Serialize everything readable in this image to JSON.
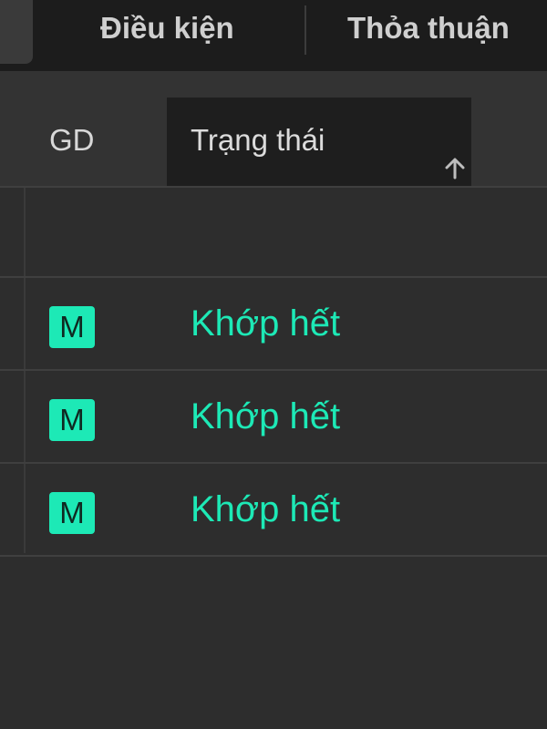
{
  "tabs": [
    {
      "label": "Điều kiện"
    },
    {
      "label": "Thỏa thuận"
    }
  ],
  "table": {
    "headers": {
      "gd": "GD",
      "status": "Trạng thái"
    },
    "sort": {
      "column": "status",
      "direction": "ascending",
      "icon": "arrow-up-icon"
    },
    "rows": [
      {
        "gd_badge": "M",
        "status": "Khớp hết"
      },
      {
        "gd_badge": "M",
        "status": "Khớp hết"
      },
      {
        "gd_badge": "M",
        "status": "Khớp hết"
      }
    ]
  },
  "colors": {
    "background": "#2d2d2d",
    "tabbar": "#1c1c1c",
    "accent_green": "#1de9b6"
  }
}
